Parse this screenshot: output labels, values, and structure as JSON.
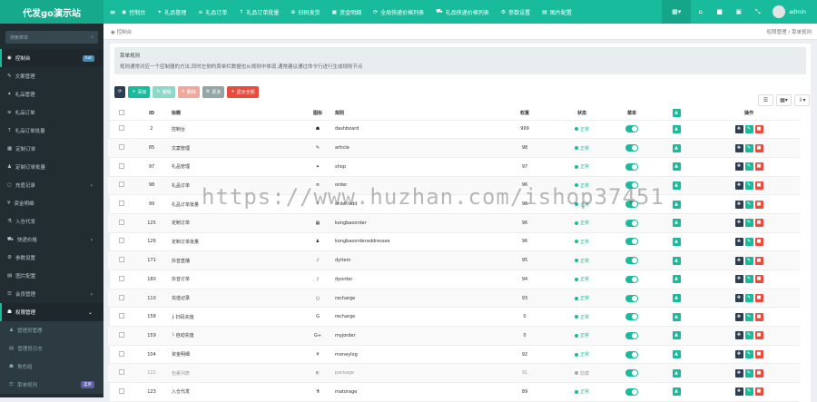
{
  "brand": "代发go演示站",
  "topnav": [
    {
      "icon": "dashboard-icon",
      "glyph": "◉",
      "label": "控制台"
    },
    {
      "icon": "gift-icon",
      "glyph": "✦",
      "label": "礼品管理"
    },
    {
      "icon": "list-icon",
      "glyph": "≡",
      "label": "礼品订单"
    },
    {
      "icon": "upload-icon",
      "glyph": "↑",
      "label": "礼品订单批量"
    },
    {
      "icon": "barcode-icon",
      "glyph": "⊕",
      "label": "扫码发货"
    },
    {
      "icon": "money-icon",
      "glyph": "▣",
      "label": "资金明细"
    },
    {
      "icon": "sync-icon",
      "glyph": "⟳",
      "label": "全局快递价格列表"
    },
    {
      "icon": "truck-icon",
      "glyph": "⛟",
      "label": "礼品快递价格列表"
    },
    {
      "icon": "gear-icon",
      "glyph": "⚙",
      "label": "参数设置"
    },
    {
      "icon": "image-icon",
      "glyph": "▤",
      "label": "图片配置"
    }
  ],
  "user": {
    "name": "admin"
  },
  "sidebar": {
    "search_placeholder": "搜索菜单",
    "items": [
      {
        "label": "控制台",
        "icon": "◉",
        "badge": "hot",
        "active": true
      },
      {
        "label": "文案管理",
        "icon": "✎"
      },
      {
        "label": "礼品管理",
        "icon": "✦"
      },
      {
        "label": "礼品订单",
        "icon": "≡"
      },
      {
        "label": "礼品订单批量",
        "icon": "↑"
      },
      {
        "label": "定制订单",
        "icon": "▦"
      },
      {
        "label": "定制订单批量",
        "icon": "♟"
      },
      {
        "label": "充值记录",
        "icon": "○",
        "arrow": "‹"
      },
      {
        "label": "资金明细",
        "icon": "¥"
      },
      {
        "label": "入仓代发",
        "icon": "⚗"
      },
      {
        "label": "快递价格",
        "icon": "⛟",
        "arrow": "‹"
      },
      {
        "label": "参数设置",
        "icon": "⚙"
      },
      {
        "label": "图片配置",
        "icon": "▤"
      },
      {
        "label": "会员管理",
        "icon": "☰",
        "arrow": "‹"
      },
      {
        "label": "权限管理",
        "icon": "☗",
        "arrow": "⌄",
        "active": true
      },
      {
        "label": "管理员管理",
        "icon": "♟",
        "sub": true
      },
      {
        "label": "管理员日志",
        "icon": "▤",
        "sub": true
      },
      {
        "label": "角色组",
        "icon": "☗",
        "sub": true
      },
      {
        "label": "菜单规则",
        "icon": "☰",
        "sub": true,
        "badge": "菜单"
      }
    ]
  },
  "breadcrumb": {
    "left": "控制台",
    "right": "权限管理 / 菜单规则"
  },
  "tip": {
    "title": "菜单规则",
    "desc": "规则通常对应一个控制器的方法,同时左侧的菜单栏数据也从规则中体现,通常建议通过命令行进行生成规则节点"
  },
  "toolbar": {
    "add": "添加",
    "edit": "编辑",
    "delete": "删除",
    "more": "更多",
    "toggle_all": "显示全部"
  },
  "table": {
    "headers": [
      "ID",
      "标题",
      "图标",
      "规则",
      "权重",
      "状态",
      "菜单",
      "操作"
    ],
    "rows": [
      {
        "id": "2",
        "title": "控制台",
        "icon": "☗",
        "rule": "dashboard",
        "weight": "999",
        "status": "正常",
        "on": true
      },
      {
        "id": "85",
        "title": "文案管理",
        "icon": "✎",
        "rule": "article",
        "weight": "98",
        "status": "正常",
        "on": true
      },
      {
        "id": "97",
        "title": "礼品管理",
        "icon": "✦",
        "rule": "shop",
        "weight": "97",
        "status": "正常",
        "on": true
      },
      {
        "id": "98",
        "title": "礼品订单",
        "icon": "≡",
        "rule": "order",
        "weight": "96",
        "status": "正常",
        "on": true
      },
      {
        "id": "99",
        "title": "礼品订单批量",
        "icon": "↑",
        "rule": "order/add",
        "weight": "96",
        "status": "正常",
        "on": true
      },
      {
        "id": "125",
        "title": "定制订单",
        "icon": "▦",
        "rule": "kongbaoorder",
        "weight": "96",
        "status": "正常",
        "on": true
      },
      {
        "id": "126",
        "title": "定制订单批量",
        "icon": "♟",
        "rule": "kongbaoorderaddressee",
        "weight": "96",
        "status": "正常",
        "on": true
      },
      {
        "id": "171",
        "title": "抖音直播",
        "icon": "♪",
        "rule": "dyitem",
        "weight": "95",
        "status": "正常",
        "on": true
      },
      {
        "id": "180",
        "title": "抖音订单",
        "icon": "♪",
        "rule": "dyorder",
        "weight": "94",
        "status": "正常",
        "on": true
      },
      {
        "id": "110",
        "title": "充值记录",
        "icon": "○",
        "rule": "recharge",
        "weight": "93",
        "status": "正常",
        "on": true
      },
      {
        "id": "158",
        "title": "├ 扫码充值",
        "icon": "G",
        "rule": "recharge",
        "weight": "0",
        "status": "正常",
        "on": true
      },
      {
        "id": "159",
        "title": "└ 自动充值",
        "icon": "G+",
        "rule": "myjorder",
        "weight": "0",
        "status": "正常",
        "on": true
      },
      {
        "id": "104",
        "title": "资金明细",
        "icon": "¥",
        "rule": "moneylog",
        "weight": "92",
        "status": "正常",
        "on": true
      },
      {
        "id": "122",
        "title": "包裹列表",
        "icon": "◐",
        "rule": "package",
        "weight": "91",
        "status": "隐藏",
        "on": true,
        "grey": true
      },
      {
        "id": "123",
        "title": "入仓代发",
        "icon": "⚗",
        "rule": "matorage",
        "weight": "89",
        "status": "正常",
        "on": true
      }
    ]
  },
  "watermark": "https://www.huzhan.com/ishop37451"
}
